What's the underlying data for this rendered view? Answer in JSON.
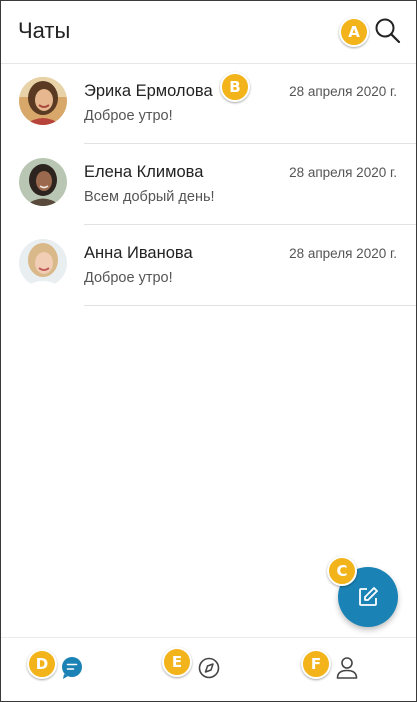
{
  "header": {
    "title": "Чаты",
    "search_icon": "search-icon"
  },
  "chats": [
    {
      "name": "Эрика Ермолова",
      "date": "28 апреля 2020 г.",
      "message": "Доброе утро!"
    },
    {
      "name": "Елена Климова",
      "date": "28 апреля 2020 г.",
      "message": "Всем добрый день!"
    },
    {
      "name": "Анна Иванова",
      "date": "28 апреля 2020 г.",
      "message": "Доброе утро!"
    }
  ],
  "callouts": {
    "a": "A",
    "b": "B",
    "c": "C",
    "d": "D",
    "e": "E",
    "f": "F"
  },
  "fab": {
    "icon": "compose-icon"
  },
  "bottom_nav": {
    "items": [
      {
        "icon": "chats-icon",
        "active": true
      },
      {
        "icon": "discover-icon",
        "active": false
      },
      {
        "icon": "profile-icon",
        "active": false
      }
    ]
  },
  "colors": {
    "accent": "#1a82b5",
    "callout": "#f2b41a",
    "divider": "#e2e2e2"
  }
}
